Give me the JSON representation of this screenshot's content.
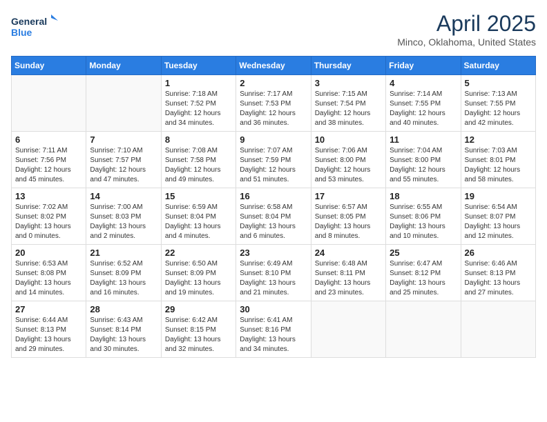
{
  "header": {
    "logo_line1": "General",
    "logo_line2": "Blue",
    "month": "April 2025",
    "location": "Minco, Oklahoma, United States"
  },
  "weekdays": [
    "Sunday",
    "Monday",
    "Tuesday",
    "Wednesday",
    "Thursday",
    "Friday",
    "Saturday"
  ],
  "weeks": [
    [
      {
        "day": "",
        "info": ""
      },
      {
        "day": "",
        "info": ""
      },
      {
        "day": "1",
        "info": "Sunrise: 7:18 AM\nSunset: 7:52 PM\nDaylight: 12 hours\nand 34 minutes."
      },
      {
        "day": "2",
        "info": "Sunrise: 7:17 AM\nSunset: 7:53 PM\nDaylight: 12 hours\nand 36 minutes."
      },
      {
        "day": "3",
        "info": "Sunrise: 7:15 AM\nSunset: 7:54 PM\nDaylight: 12 hours\nand 38 minutes."
      },
      {
        "day": "4",
        "info": "Sunrise: 7:14 AM\nSunset: 7:55 PM\nDaylight: 12 hours\nand 40 minutes."
      },
      {
        "day": "5",
        "info": "Sunrise: 7:13 AM\nSunset: 7:55 PM\nDaylight: 12 hours\nand 42 minutes."
      }
    ],
    [
      {
        "day": "6",
        "info": "Sunrise: 7:11 AM\nSunset: 7:56 PM\nDaylight: 12 hours\nand 45 minutes."
      },
      {
        "day": "7",
        "info": "Sunrise: 7:10 AM\nSunset: 7:57 PM\nDaylight: 12 hours\nand 47 minutes."
      },
      {
        "day": "8",
        "info": "Sunrise: 7:08 AM\nSunset: 7:58 PM\nDaylight: 12 hours\nand 49 minutes."
      },
      {
        "day": "9",
        "info": "Sunrise: 7:07 AM\nSunset: 7:59 PM\nDaylight: 12 hours\nand 51 minutes."
      },
      {
        "day": "10",
        "info": "Sunrise: 7:06 AM\nSunset: 8:00 PM\nDaylight: 12 hours\nand 53 minutes."
      },
      {
        "day": "11",
        "info": "Sunrise: 7:04 AM\nSunset: 8:00 PM\nDaylight: 12 hours\nand 55 minutes."
      },
      {
        "day": "12",
        "info": "Sunrise: 7:03 AM\nSunset: 8:01 PM\nDaylight: 12 hours\nand 58 minutes."
      }
    ],
    [
      {
        "day": "13",
        "info": "Sunrise: 7:02 AM\nSunset: 8:02 PM\nDaylight: 13 hours\nand 0 minutes."
      },
      {
        "day": "14",
        "info": "Sunrise: 7:00 AM\nSunset: 8:03 PM\nDaylight: 13 hours\nand 2 minutes."
      },
      {
        "day": "15",
        "info": "Sunrise: 6:59 AM\nSunset: 8:04 PM\nDaylight: 13 hours\nand 4 minutes."
      },
      {
        "day": "16",
        "info": "Sunrise: 6:58 AM\nSunset: 8:04 PM\nDaylight: 13 hours\nand 6 minutes."
      },
      {
        "day": "17",
        "info": "Sunrise: 6:57 AM\nSunset: 8:05 PM\nDaylight: 13 hours\nand 8 minutes."
      },
      {
        "day": "18",
        "info": "Sunrise: 6:55 AM\nSunset: 8:06 PM\nDaylight: 13 hours\nand 10 minutes."
      },
      {
        "day": "19",
        "info": "Sunrise: 6:54 AM\nSunset: 8:07 PM\nDaylight: 13 hours\nand 12 minutes."
      }
    ],
    [
      {
        "day": "20",
        "info": "Sunrise: 6:53 AM\nSunset: 8:08 PM\nDaylight: 13 hours\nand 14 minutes."
      },
      {
        "day": "21",
        "info": "Sunrise: 6:52 AM\nSunset: 8:09 PM\nDaylight: 13 hours\nand 16 minutes."
      },
      {
        "day": "22",
        "info": "Sunrise: 6:50 AM\nSunset: 8:09 PM\nDaylight: 13 hours\nand 19 minutes."
      },
      {
        "day": "23",
        "info": "Sunrise: 6:49 AM\nSunset: 8:10 PM\nDaylight: 13 hours\nand 21 minutes."
      },
      {
        "day": "24",
        "info": "Sunrise: 6:48 AM\nSunset: 8:11 PM\nDaylight: 13 hours\nand 23 minutes."
      },
      {
        "day": "25",
        "info": "Sunrise: 6:47 AM\nSunset: 8:12 PM\nDaylight: 13 hours\nand 25 minutes."
      },
      {
        "day": "26",
        "info": "Sunrise: 6:46 AM\nSunset: 8:13 PM\nDaylight: 13 hours\nand 27 minutes."
      }
    ],
    [
      {
        "day": "27",
        "info": "Sunrise: 6:44 AM\nSunset: 8:13 PM\nDaylight: 13 hours\nand 29 minutes."
      },
      {
        "day": "28",
        "info": "Sunrise: 6:43 AM\nSunset: 8:14 PM\nDaylight: 13 hours\nand 30 minutes."
      },
      {
        "day": "29",
        "info": "Sunrise: 6:42 AM\nSunset: 8:15 PM\nDaylight: 13 hours\nand 32 minutes."
      },
      {
        "day": "30",
        "info": "Sunrise: 6:41 AM\nSunset: 8:16 PM\nDaylight: 13 hours\nand 34 minutes."
      },
      {
        "day": "",
        "info": ""
      },
      {
        "day": "",
        "info": ""
      },
      {
        "day": "",
        "info": ""
      }
    ]
  ]
}
